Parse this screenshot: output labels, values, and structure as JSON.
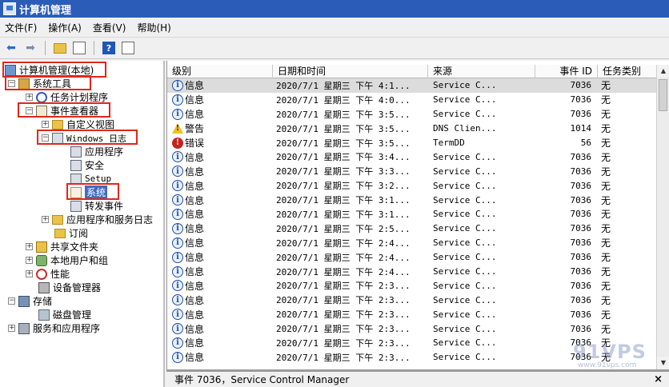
{
  "window": {
    "title": "计算机管理"
  },
  "menu": [
    "文件(F)",
    "操作(A)",
    "查看(V)",
    "帮助(H)"
  ],
  "toolbar": {
    "back_icon": "back-arrow-icon",
    "forward_icon": "forward-arrow-icon",
    "help_label": "?"
  },
  "tree": {
    "root": "计算机管理(本地)",
    "system_tools": "系统工具",
    "task_scheduler": "任务计划程序",
    "event_viewer": "事件查看器",
    "custom_views": "自定义视图",
    "windows_logs": "Windows 日志",
    "application": "应用程序",
    "security": "安全",
    "setup": "Setup",
    "system": "系统",
    "forwarded_events": "转发事件",
    "app_service_logs": "应用程序和服务日志",
    "subscriptions": "订阅",
    "shared_folders": "共享文件夹",
    "local_users_groups": "本地用户和组",
    "performance": "性能",
    "device_manager": "设备管理器",
    "storage": "存储",
    "disk_management": "磁盘管理",
    "services_apps": "服务和应用程序"
  },
  "columns": [
    "级别",
    "日期和时间",
    "来源",
    "事件 ID",
    "任务类别"
  ],
  "rows": [
    {
      "level": "info",
      "level_text": "信息",
      "date": "2020/7/1 星期三 下午 4:1...",
      "source": "Service C...",
      "id": "7036",
      "task": "无"
    },
    {
      "level": "info",
      "level_text": "信息",
      "date": "2020/7/1 星期三 下午 4:0...",
      "source": "Service C...",
      "id": "7036",
      "task": "无"
    },
    {
      "level": "info",
      "level_text": "信息",
      "date": "2020/7/1 星期三 下午 3:5...",
      "source": "Service C...",
      "id": "7036",
      "task": "无"
    },
    {
      "level": "warn",
      "level_text": "警告",
      "date": "2020/7/1 星期三 下午 3:5...",
      "source": "DNS Clien...",
      "id": "1014",
      "task": "无"
    },
    {
      "level": "error",
      "level_text": "错误",
      "date": "2020/7/1 星期三 下午 3:5...",
      "source": "TermDD",
      "id": "56",
      "task": "无"
    },
    {
      "level": "info",
      "level_text": "信息",
      "date": "2020/7/1 星期三 下午 3:4...",
      "source": "Service C...",
      "id": "7036",
      "task": "无"
    },
    {
      "level": "info",
      "level_text": "信息",
      "date": "2020/7/1 星期三 下午 3:3...",
      "source": "Service C...",
      "id": "7036",
      "task": "无"
    },
    {
      "level": "info",
      "level_text": "信息",
      "date": "2020/7/1 星期三 下午 3:2...",
      "source": "Service C...",
      "id": "7036",
      "task": "无"
    },
    {
      "level": "info",
      "level_text": "信息",
      "date": "2020/7/1 星期三 下午 3:1...",
      "source": "Service C...",
      "id": "7036",
      "task": "无"
    },
    {
      "level": "info",
      "level_text": "信息",
      "date": "2020/7/1 星期三 下午 3:1...",
      "source": "Service C...",
      "id": "7036",
      "task": "无"
    },
    {
      "level": "info",
      "level_text": "信息",
      "date": "2020/7/1 星期三 下午 2:5...",
      "source": "Service C...",
      "id": "7036",
      "task": "无"
    },
    {
      "level": "info",
      "level_text": "信息",
      "date": "2020/7/1 星期三 下午 2:4...",
      "source": "Service C...",
      "id": "7036",
      "task": "无"
    },
    {
      "level": "info",
      "level_text": "信息",
      "date": "2020/7/1 星期三 下午 2:4...",
      "source": "Service C...",
      "id": "7036",
      "task": "无"
    },
    {
      "level": "info",
      "level_text": "信息",
      "date": "2020/7/1 星期三 下午 2:4...",
      "source": "Service C...",
      "id": "7036",
      "task": "无"
    },
    {
      "level": "info",
      "level_text": "信息",
      "date": "2020/7/1 星期三 下午 2:3...",
      "source": "Service C...",
      "id": "7036",
      "task": "无"
    },
    {
      "level": "info",
      "level_text": "信息",
      "date": "2020/7/1 星期三 下午 2:3...",
      "source": "Service C...",
      "id": "7036",
      "task": "无"
    },
    {
      "level": "info",
      "level_text": "信息",
      "date": "2020/7/1 星期三 下午 2:3...",
      "source": "Service C...",
      "id": "7036",
      "task": "无"
    },
    {
      "level": "info",
      "level_text": "信息",
      "date": "2020/7/1 星期三 下午 2:3...",
      "source": "Service C...",
      "id": "7036",
      "task": "无"
    },
    {
      "level": "info",
      "level_text": "信息",
      "date": "2020/7/1 星期三 下午 2:3...",
      "source": "Service C...",
      "id": "7036",
      "task": "无"
    },
    {
      "level": "info",
      "level_text": "信息",
      "date": "2020/7/1 星期三 下午 2:3...",
      "source": "Service C...",
      "id": "7036",
      "task": "无"
    }
  ],
  "detail": {
    "title": "事件 7036，Service Control Manager",
    "close_label": "×"
  },
  "watermark": {
    "main": "91VPS",
    "sub": "www.91vps.com"
  },
  "colors": {
    "titlebar": "#2b5cb8",
    "highlight_box": "#e1261c"
  }
}
